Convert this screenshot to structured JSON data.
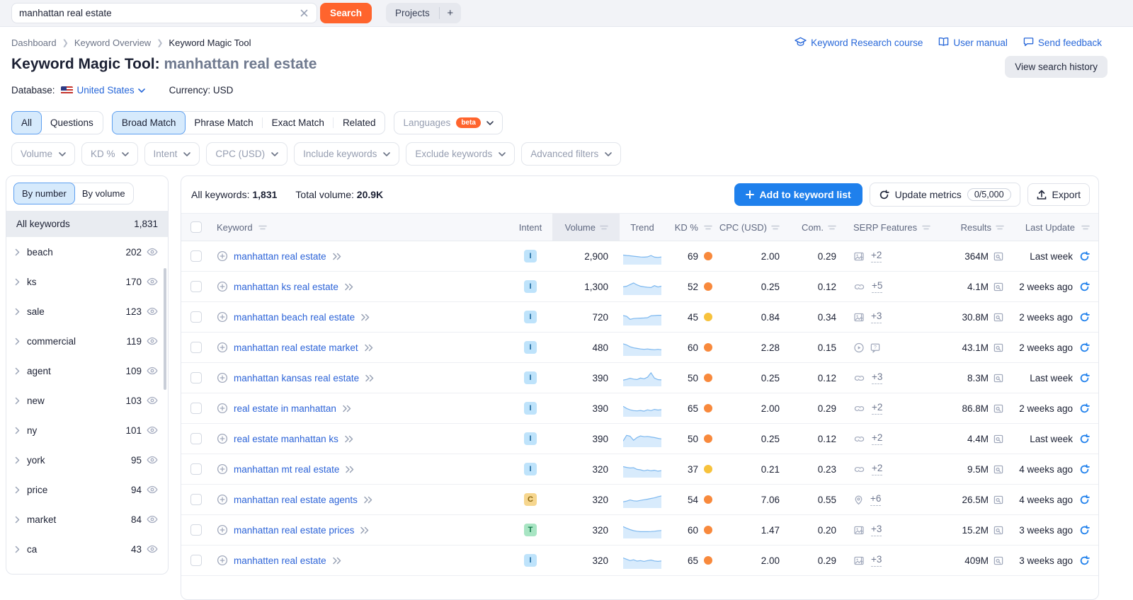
{
  "colors": {
    "accent_orange": "#ff642d",
    "primary_blue": "#1f80ec",
    "link_blue": "#2d64d8",
    "kd_orange": "#f8893c",
    "kd_yellow": "#f7c23c",
    "intent_informational_bg": "#bee3fb",
    "intent_commercial_bg": "#f6d68e",
    "intent_transactional_bg": "#a8e5c3",
    "trend_fill": "#d8ebfc",
    "trend_line": "#7db8ef"
  },
  "topbar": {
    "search_value": "manhattan real estate",
    "search_button": "Search",
    "projects_label": "Projects",
    "add_project_label": "+"
  },
  "breadcrumb": {
    "items": [
      "Dashboard",
      "Keyword Overview",
      "Keyword Magic Tool"
    ]
  },
  "header_links": {
    "course": "Keyword Research course",
    "manual": "User manual",
    "feedback": "Send feedback",
    "history_button": "View search history"
  },
  "title": {
    "prefix": "Keyword Magic Tool:",
    "query": "manhattan real estate"
  },
  "meta": {
    "database_label": "Database:",
    "database_value": "United States",
    "currency_label": "Currency:",
    "currency_value": "USD"
  },
  "tabs": {
    "group1": [
      {
        "label": "All",
        "active": true
      },
      {
        "label": "Questions",
        "active": false
      }
    ],
    "group2": [
      {
        "label": "Broad Match",
        "active": true
      },
      {
        "label": "Phrase Match",
        "active": false
      },
      {
        "label": "Exact Match",
        "active": false
      },
      {
        "label": "Related",
        "active": false
      }
    ],
    "languages": {
      "label": "Languages",
      "badge": "beta"
    }
  },
  "filters": [
    "Volume",
    "KD %",
    "Intent",
    "CPC (USD)",
    "Include keywords",
    "Exclude keywords",
    "Advanced filters"
  ],
  "sidebar": {
    "toggle": [
      {
        "label": "By number",
        "active": true
      },
      {
        "label": "By volume",
        "active": false
      }
    ],
    "all_row": {
      "label": "All keywords",
      "count": "1,831"
    },
    "groups": [
      {
        "name": "beach",
        "count": "202"
      },
      {
        "name": "ks",
        "count": "170"
      },
      {
        "name": "sale",
        "count": "123"
      },
      {
        "name": "commercial",
        "count": "119"
      },
      {
        "name": "agent",
        "count": "109"
      },
      {
        "name": "new",
        "count": "103"
      },
      {
        "name": "ny",
        "count": "101"
      },
      {
        "name": "york",
        "count": "95"
      },
      {
        "name": "price",
        "count": "94"
      },
      {
        "name": "market",
        "count": "84"
      },
      {
        "name": "ca",
        "count": "43"
      }
    ]
  },
  "toolbar": {
    "all_keywords_label": "All keywords:",
    "all_keywords_value": "1,831",
    "total_volume_label": "Total volume:",
    "total_volume_value": "20.9K",
    "add_button": "Add to keyword list",
    "update_button": "Update metrics",
    "update_quota": "0/5,000",
    "export_button": "Export"
  },
  "table": {
    "columns": [
      {
        "key": "kw",
        "label": "Keyword",
        "sortable": true
      },
      {
        "key": "intent",
        "label": "Intent",
        "sortable": false
      },
      {
        "key": "volume",
        "label": "Volume",
        "sortable": true,
        "highlight": true
      },
      {
        "key": "trend",
        "label": "Trend",
        "sortable": false
      },
      {
        "key": "kd",
        "label": "KD %",
        "sortable": true
      },
      {
        "key": "cpc",
        "label": "CPC (USD)",
        "sortable": true
      },
      {
        "key": "com",
        "label": "Com.",
        "sortable": true
      },
      {
        "key": "serp",
        "label": "SERP Features",
        "sortable": true
      },
      {
        "key": "results",
        "label": "Results",
        "sortable": true
      },
      {
        "key": "update",
        "label": "Last Update",
        "sortable": true
      }
    ],
    "rows": [
      {
        "keyword": "manhattan real estate",
        "intent": "I",
        "volume": "2,900",
        "kd": "69",
        "kd_level": "orange",
        "cpc": "2.00",
        "com": "0.29",
        "serp_icons": [
          "image"
        ],
        "serp_plus": "+2",
        "results": "364M",
        "last_update": "Last week",
        "trend": [
          0.55,
          0.52,
          0.5,
          0.47,
          0.44,
          0.41,
          0.4,
          0.42,
          0.52,
          0.4,
          0.38,
          0.41
        ]
      },
      {
        "keyword": "manhattan ks real estate",
        "intent": "I",
        "volume": "1,300",
        "kd": "52",
        "kd_level": "orange",
        "cpc": "0.25",
        "com": "0.12",
        "serp_icons": [
          "link"
        ],
        "serp_plus": "+5",
        "results": "4.1M",
        "last_update": "2 weeks ago",
        "trend": [
          0.45,
          0.5,
          0.62,
          0.74,
          0.6,
          0.5,
          0.45,
          0.42,
          0.4,
          0.54,
          0.44,
          0.5
        ]
      },
      {
        "keyword": "manhattan beach real estate",
        "intent": "I",
        "volume": "720",
        "kd": "45",
        "kd_level": "yellow",
        "cpc": "0.84",
        "com": "0.34",
        "serp_icons": [
          "image"
        ],
        "serp_plus": "+3",
        "results": "30.8M",
        "last_update": "2 weeks ago",
        "trend": [
          0.58,
          0.52,
          0.3,
          0.36,
          0.38,
          0.39,
          0.4,
          0.42,
          0.56,
          0.58,
          0.6,
          0.6
        ]
      },
      {
        "keyword": "manhattan real estate market",
        "intent": "I",
        "volume": "480",
        "kd": "60",
        "kd_level": "orange",
        "cpc": "2.28",
        "com": "0.15",
        "serp_icons": [
          "video",
          "faq"
        ],
        "serp_plus": "",
        "results": "43.1M",
        "last_update": "2 weeks ago",
        "trend": [
          0.74,
          0.66,
          0.52,
          0.44,
          0.4,
          0.36,
          0.33,
          0.36,
          0.32,
          0.3,
          0.33,
          0.3
        ]
      },
      {
        "keyword": "manhattan kansas real estate",
        "intent": "I",
        "volume": "390",
        "kd": "50",
        "kd_level": "orange",
        "cpc": "0.25",
        "com": "0.12",
        "serp_icons": [
          "link"
        ],
        "serp_plus": "+3",
        "results": "8.3M",
        "last_update": "Last week",
        "trend": [
          0.3,
          0.36,
          0.44,
          0.38,
          0.35,
          0.46,
          0.4,
          0.52,
          0.85,
          0.45,
          0.34,
          0.32
        ]
      },
      {
        "keyword": "real estate in manhattan",
        "intent": "I",
        "volume": "390",
        "kd": "65",
        "kd_level": "orange",
        "cpc": "2.00",
        "com": "0.29",
        "serp_icons": [
          "link"
        ],
        "serp_plus": "+2",
        "results": "86.8M",
        "last_update": "2 weeks ago",
        "trend": [
          0.62,
          0.46,
          0.36,
          0.3,
          0.28,
          0.31,
          0.26,
          0.36,
          0.3,
          0.39,
          0.34,
          0.37
        ]
      },
      {
        "keyword": "real estate manhattan ks",
        "intent": "I",
        "volume": "390",
        "kd": "50",
        "kd_level": "orange",
        "cpc": "0.25",
        "com": "0.12",
        "serp_icons": [
          "link"
        ],
        "serp_plus": "+2",
        "results": "4.4M",
        "last_update": "Last week",
        "trend": [
          0.3,
          0.72,
          0.66,
          0.36,
          0.56,
          0.68,
          0.62,
          0.64,
          0.6,
          0.56,
          0.5,
          0.46
        ]
      },
      {
        "keyword": "manhattan mt real estate",
        "intent": "I",
        "volume": "320",
        "kd": "37",
        "kd_level": "yellow",
        "cpc": "0.21",
        "com": "0.23",
        "serp_icons": [
          "link"
        ],
        "serp_plus": "+2",
        "results": "9.5M",
        "last_update": "4 weeks ago",
        "trend": [
          0.66,
          0.6,
          0.56,
          0.58,
          0.45,
          0.42,
          0.35,
          0.41,
          0.35,
          0.39,
          0.32,
          0.36
        ]
      },
      {
        "keyword": "manhattan real estate agents",
        "intent": "C",
        "volume": "320",
        "kd": "54",
        "kd_level": "orange",
        "cpc": "7.06",
        "com": "0.55",
        "serp_icons": [
          "pin"
        ],
        "serp_plus": "+6",
        "results": "26.5M",
        "last_update": "4 weeks ago",
        "trend": [
          0.3,
          0.36,
          0.44,
          0.38,
          0.36,
          0.41,
          0.46,
          0.5,
          0.55,
          0.6,
          0.68,
          0.74
        ]
      },
      {
        "keyword": "manhattan real estate prices",
        "intent": "T",
        "volume": "320",
        "kd": "60",
        "kd_level": "orange",
        "cpc": "1.47",
        "com": "0.20",
        "serp_icons": [
          "image"
        ],
        "serp_plus": "+3",
        "results": "15.2M",
        "last_update": "3 weeks ago",
        "trend": [
          0.72,
          0.6,
          0.5,
          0.42,
          0.38,
          0.35,
          0.35,
          0.35,
          0.36,
          0.38,
          0.41,
          0.43
        ]
      },
      {
        "keyword": "manhatten real estate",
        "intent": "I",
        "volume": "320",
        "kd": "65",
        "kd_level": "orange",
        "cpc": "2.00",
        "com": "0.29",
        "serp_icons": [
          "image"
        ],
        "serp_plus": "+3",
        "results": "409M",
        "last_update": "3 weeks ago",
        "trend": [
          0.66,
          0.56,
          0.46,
          0.52,
          0.42,
          0.46,
          0.4,
          0.46,
          0.5,
          0.43,
          0.4,
          0.43
        ]
      }
    ]
  }
}
